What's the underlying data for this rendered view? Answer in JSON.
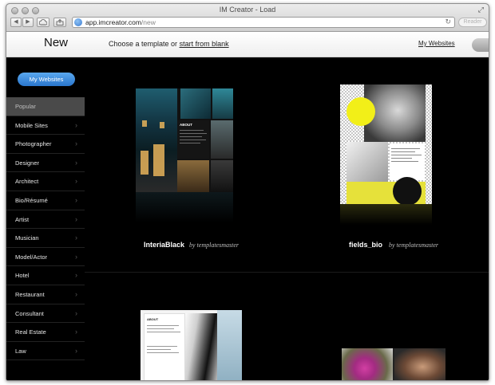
{
  "window": {
    "title": "IM Creator - Load",
    "resize_glyph": "⤢"
  },
  "browser": {
    "url_host": "app.imcreator.com",
    "url_path": "/new",
    "reader_label": "Reader",
    "back_glyph": "◀",
    "forward_glyph": "▶",
    "reload_glyph": "↻"
  },
  "appbar": {
    "title": "New",
    "choose_prefix": "Choose a template or ",
    "start_blank_link": "start from blank",
    "my_websites_link": "My Websites"
  },
  "sidebar": {
    "my_websites_button": "My Websites",
    "categories": [
      {
        "label": "Popular",
        "active": true
      },
      {
        "label": "Mobile Sites"
      },
      {
        "label": "Photographer"
      },
      {
        "label": "Designer"
      },
      {
        "label": "Architect"
      },
      {
        "label": "Bio/Résumé"
      },
      {
        "label": "Artist"
      },
      {
        "label": "Musician"
      },
      {
        "label": "Model/Actor"
      },
      {
        "label": "Hotel"
      },
      {
        "label": "Restaurant"
      },
      {
        "label": "Consultant"
      },
      {
        "label": "Real Estate"
      },
      {
        "label": "Law"
      }
    ],
    "chevron_glyph": "›"
  },
  "templates": [
    {
      "name": "InteriaBlack",
      "author": "by templatesmaster",
      "thumb_heading": "ABOUT"
    },
    {
      "name": "fields_bio",
      "author": "by templatesmaster"
    },
    {
      "thumb_heading": "ABOUT"
    }
  ]
}
